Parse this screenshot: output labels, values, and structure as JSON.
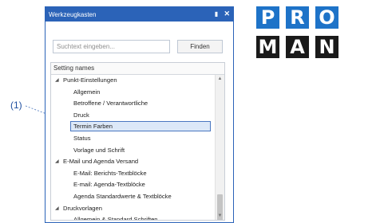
{
  "callout": {
    "label": "(1)"
  },
  "window": {
    "title": "Werkzeugkasten",
    "pin_glyph": "p",
    "close_glyph": "✕"
  },
  "search": {
    "placeholder": "Suchtext eingeben...",
    "find_label": "Finden"
  },
  "tree": {
    "header": "Setting names",
    "expanded_glyph": "◢",
    "rows": [
      {
        "label": "Punkt-Einstellungen",
        "level": 0,
        "expanded": true
      },
      {
        "label": "Allgemein",
        "level": 1
      },
      {
        "label": "Betroffene / Verantwortliche",
        "level": 1
      },
      {
        "label": "Druck",
        "level": 1
      },
      {
        "label": "Termin Farben",
        "level": 1,
        "selected": true
      },
      {
        "label": "Status",
        "level": 1
      },
      {
        "label": "Vorlage und Schrift",
        "level": 1
      },
      {
        "label": "E-Mail und Agenda Versand",
        "level": 0,
        "expanded": true
      },
      {
        "label": "E-Mail: Berichts-Textblöcke",
        "level": 1
      },
      {
        "label": "E-mail: Agenda-Textblöcke",
        "level": 1
      },
      {
        "label": "Agenda Standardwerte & Textblöcke",
        "level": 1
      },
      {
        "label": "Druckvorlagen",
        "level": 0,
        "expanded": true
      },
      {
        "label": "Allgemein & Standard Schriften",
        "level": 1
      }
    ]
  },
  "scrollbar": {
    "up_glyph": "▲",
    "down_glyph": "▼"
  },
  "logo": {
    "row1": [
      "P",
      "R",
      "O"
    ],
    "row2": [
      "M",
      "A",
      "N"
    ],
    "colors": {
      "top": "#1e73c8",
      "bottom": "#1a1a1a"
    }
  }
}
